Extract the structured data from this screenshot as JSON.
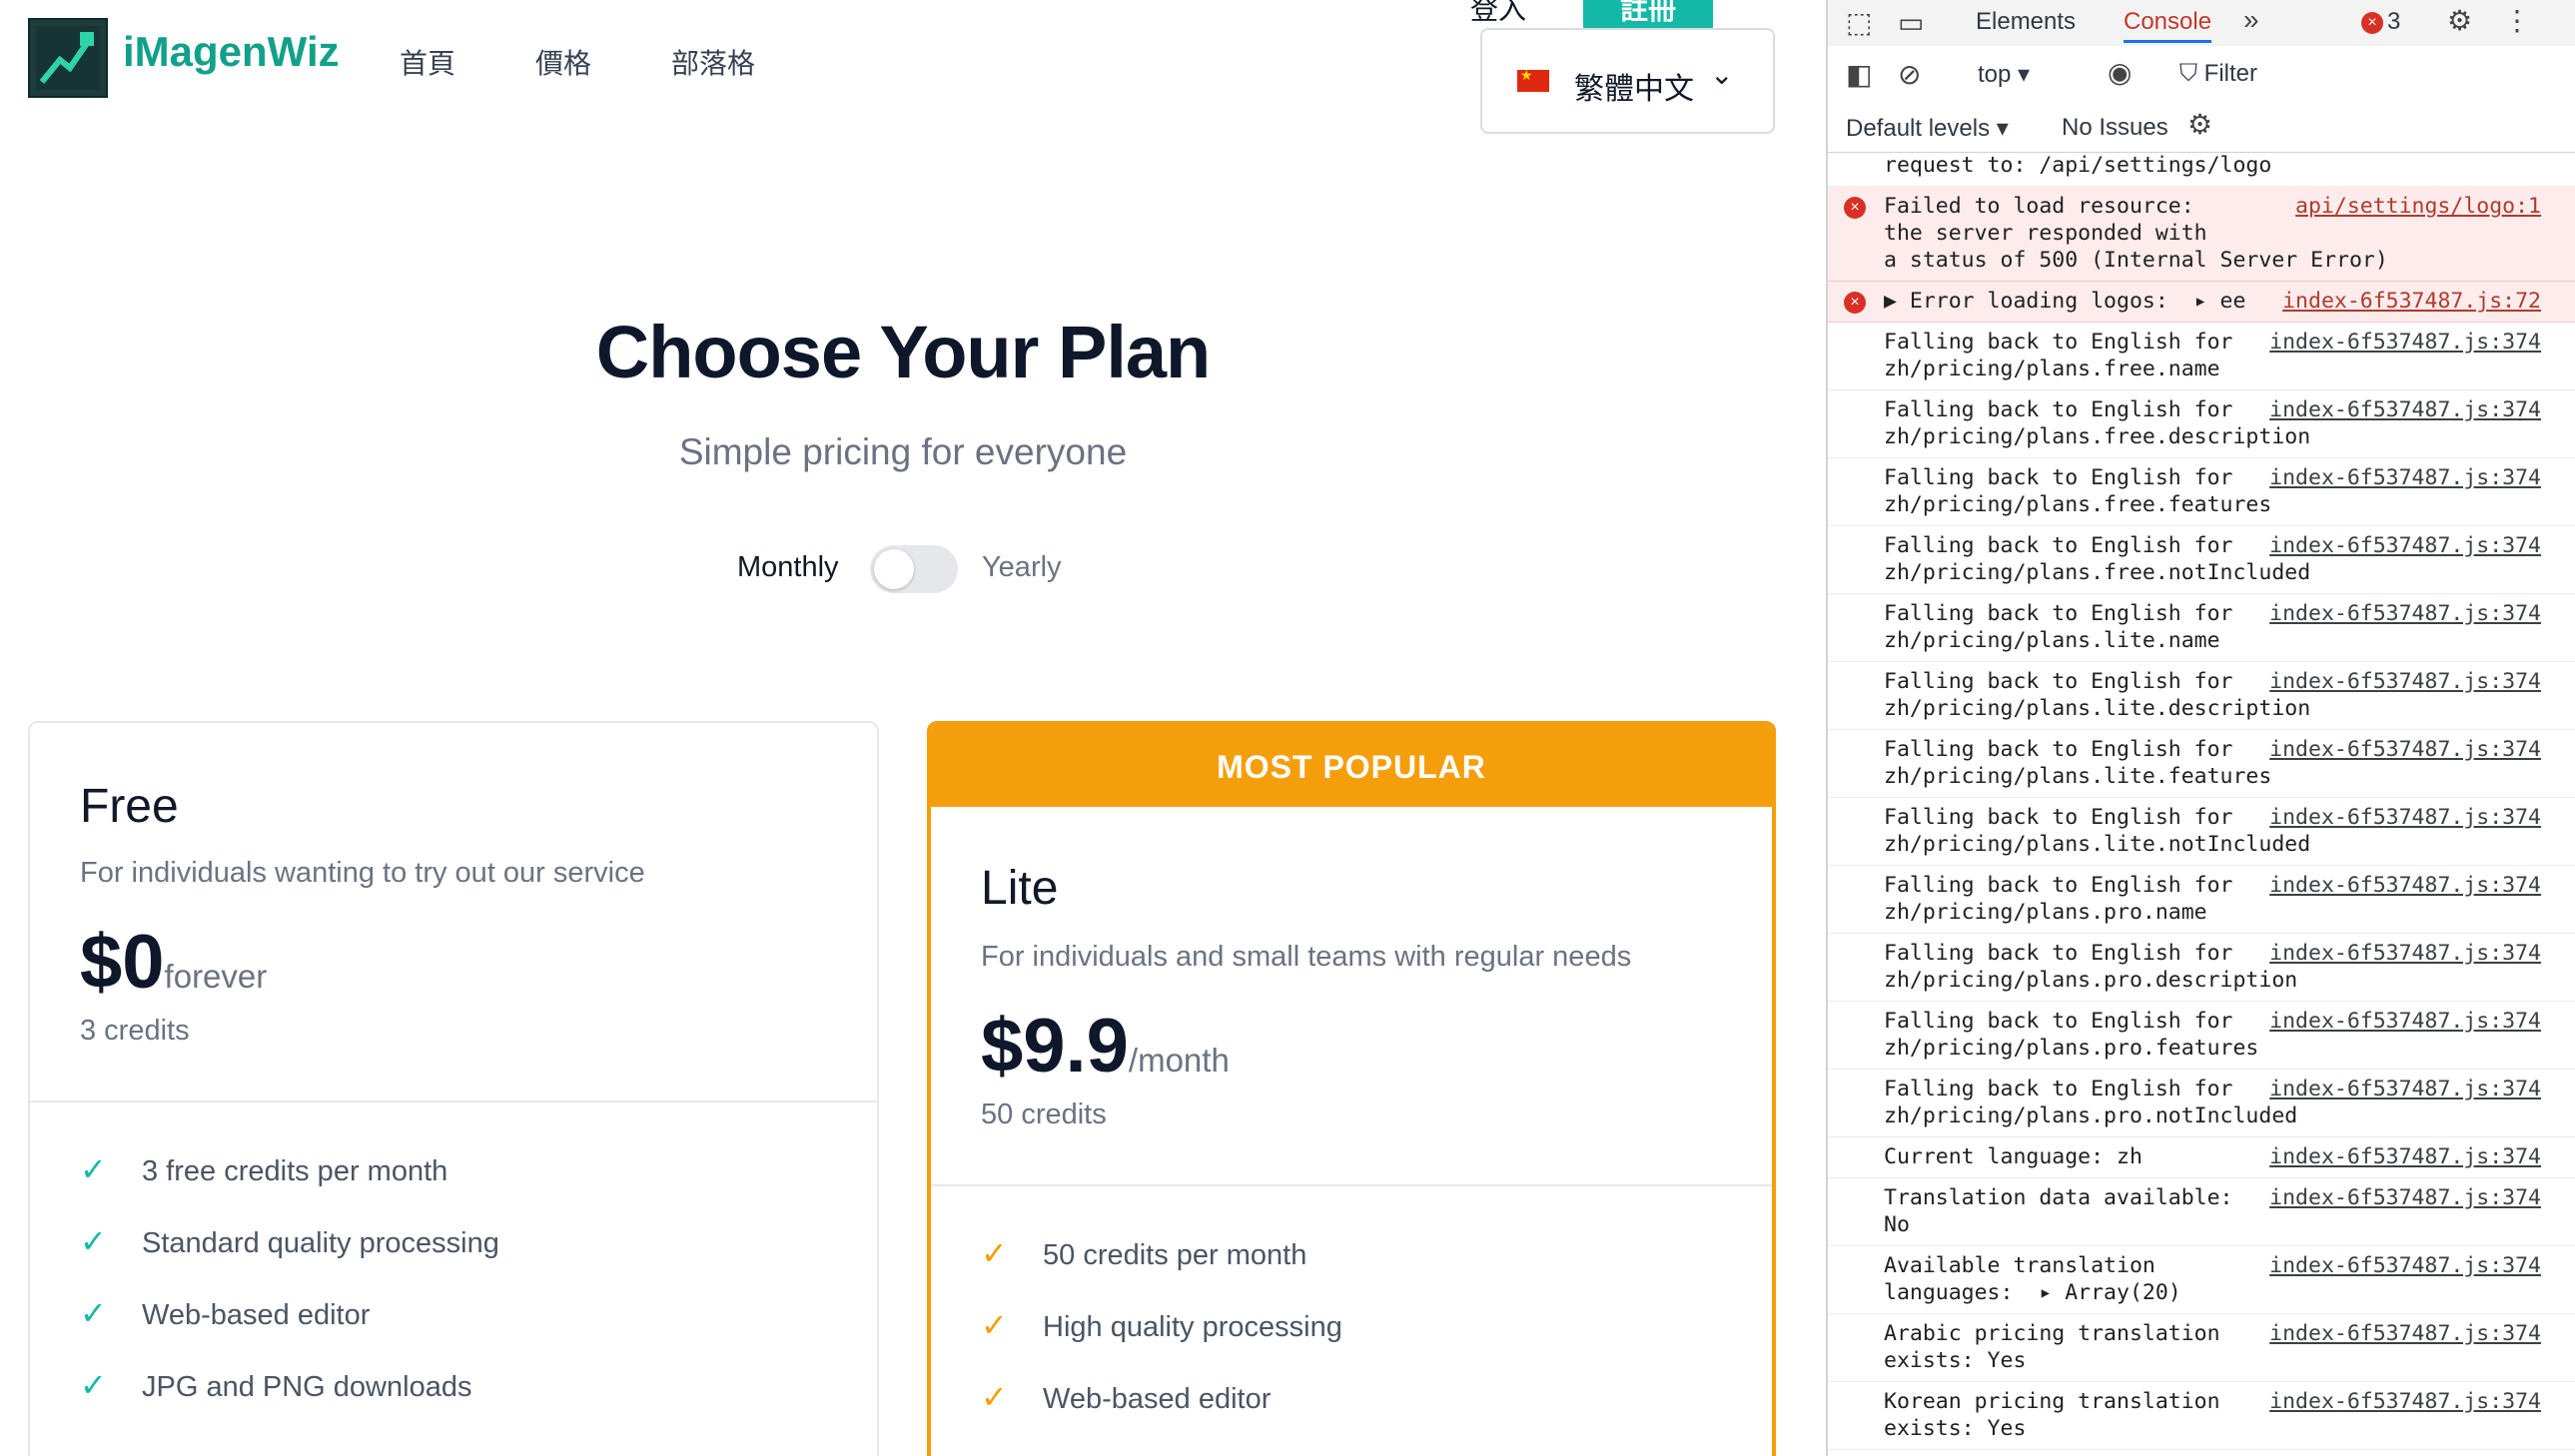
{
  "header": {
    "brand": "iMagenWiz",
    "nav": [
      "首頁",
      "價格",
      "部落格"
    ],
    "login_label": "登入",
    "register_label": "註冊",
    "language": "繁體中文"
  },
  "hero": {
    "title": "Choose Your Plan",
    "subtitle": "Simple pricing for everyone",
    "toggle_monthly": "Monthly",
    "toggle_yearly": "Yearly",
    "yearly_selected": false
  },
  "plans": [
    {
      "name": "Free",
      "description": "For individuals wanting to try out our service",
      "price": "$0",
      "period": "forever",
      "credits": "3 credits",
      "features": [
        "3 free credits per month",
        "Standard quality processing",
        "Web-based editor",
        "JPG and PNG downloads"
      ]
    },
    {
      "badge": "MOST POPULAR",
      "name": "Lite",
      "description": "For individuals and small teams with regular needs",
      "price": "$9.9",
      "period": "/month",
      "credits": "50 credits",
      "features": [
        "50 credits per month",
        "High quality processing",
        "Web-based editor"
      ]
    }
  ],
  "devtools": {
    "tabs": [
      "Elements",
      "Console"
    ],
    "error_count": "3",
    "context": "top ▾",
    "filter_placeholder": "Filter",
    "levels": "Default levels ▾",
    "issues": "No Issues",
    "messages": [
      {
        "type": "log",
        "text": "request to: /api/settings/logo",
        "link": ""
      },
      {
        "type": "error",
        "text": "Failed to load resource:\nthe server responded with\na status of 500 (Internal Server Error)",
        "link": "api/settings/logo:1"
      },
      {
        "type": "error",
        "text": "▶ Error loading logos:  ▸ ee",
        "link": "index-6f537487.js:72"
      },
      {
        "type": "log",
        "text": "Falling back to English for\nzh/pricing/plans.free.name",
        "link": "index-6f537487.js:374"
      },
      {
        "type": "log",
        "text": "Falling back to English for\nzh/pricing/plans.free.description",
        "link": "index-6f537487.js:374"
      },
      {
        "type": "log",
        "text": "Falling back to English for\nzh/pricing/plans.free.features",
        "link": "index-6f537487.js:374"
      },
      {
        "type": "log",
        "text": "Falling back to English for\nzh/pricing/plans.free.notIncluded",
        "link": "index-6f537487.js:374"
      },
      {
        "type": "log",
        "text": "Falling back to English for\nzh/pricing/plans.lite.name",
        "link": "index-6f537487.js:374"
      },
      {
        "type": "log",
        "text": "Falling back to English for\nzh/pricing/plans.lite.description",
        "link": "index-6f537487.js:374"
      },
      {
        "type": "log",
        "text": "Falling back to English for\nzh/pricing/plans.lite.features",
        "link": "index-6f537487.js:374"
      },
      {
        "type": "log",
        "text": "Falling back to English for\nzh/pricing/plans.lite.notIncluded",
        "link": "index-6f537487.js:374"
      },
      {
        "type": "log",
        "text": "Falling back to English for\nzh/pricing/plans.pro.name",
        "link": "index-6f537487.js:374"
      },
      {
        "type": "log",
        "text": "Falling back to English for\nzh/pricing/plans.pro.description",
        "link": "index-6f537487.js:374"
      },
      {
        "type": "log",
        "text": "Falling back to English for\nzh/pricing/plans.pro.features",
        "link": "index-6f537487.js:374"
      },
      {
        "type": "log",
        "text": "Falling back to English for\nzh/pricing/plans.pro.notIncluded",
        "link": "index-6f537487.js:374"
      },
      {
        "type": "log",
        "text": "Current language: zh",
        "link": "index-6f537487.js:374"
      },
      {
        "type": "log",
        "text": "Translation data available:\nNo",
        "link": "index-6f537487.js:374"
      },
      {
        "type": "log",
        "text": "Available translation\nlanguages:  ▸ Array(20)",
        "link": "index-6f537487.js:374"
      },
      {
        "type": "log",
        "text": "Arabic pricing translation\nexists: Yes",
        "link": "index-6f537487.js:374"
      },
      {
        "type": "log",
        "text": "Korean pricing translation\nexists: Yes",
        "link": "index-6f537487.js:374"
      }
    ]
  }
}
